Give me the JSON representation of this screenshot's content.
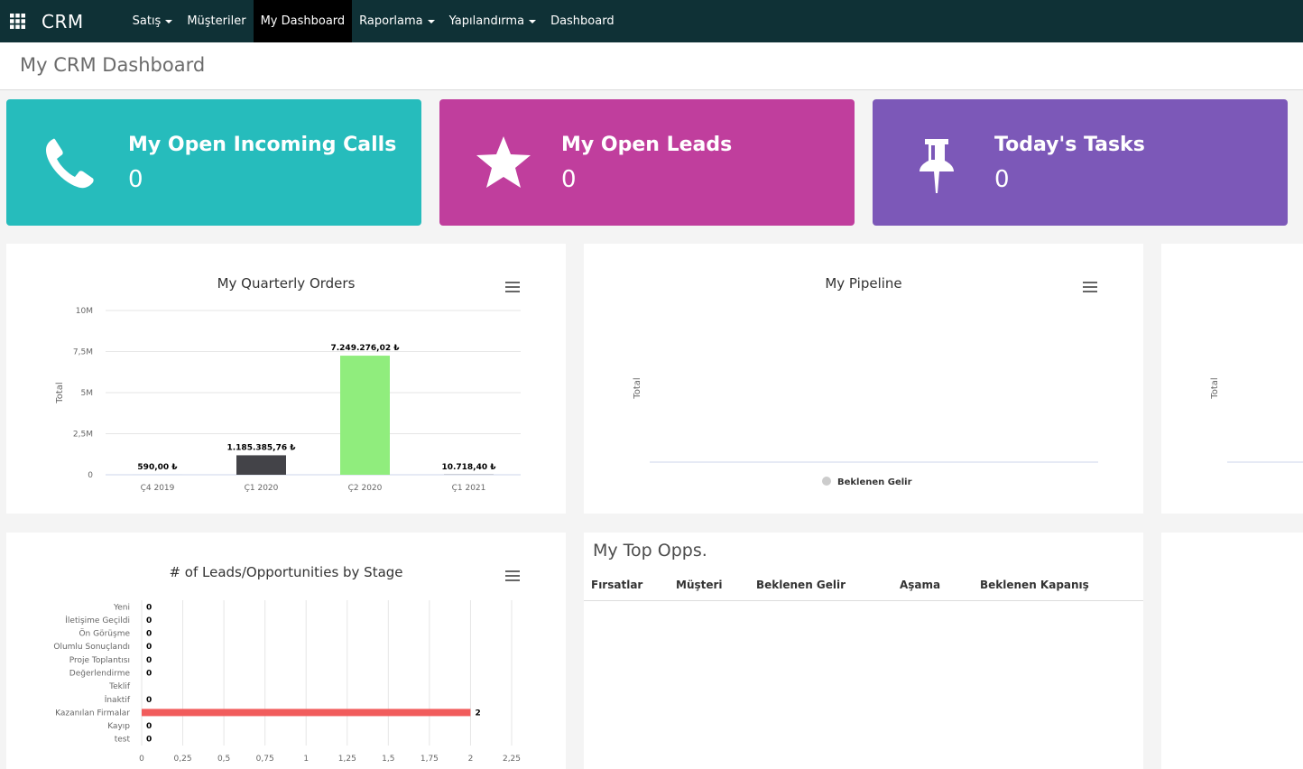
{
  "navbar": {
    "brand": "CRM",
    "menu": [
      {
        "label": "Satış",
        "dropdown": true
      },
      {
        "label": "Müşteriler",
        "dropdown": false
      },
      {
        "label": "My Dashboard",
        "dropdown": false,
        "active": true
      },
      {
        "label": "Raporlama",
        "dropdown": true
      },
      {
        "label": "Yapılandırma",
        "dropdown": true
      },
      {
        "label": "Dashboard",
        "dropdown": false
      }
    ]
  },
  "page": {
    "title": "My CRM Dashboard"
  },
  "kpis": [
    {
      "title": "My Open Incoming Calls",
      "value": "0",
      "icon": "phone-icon",
      "color": "#26bcbc"
    },
    {
      "title": "My Open Leads",
      "value": "0",
      "icon": "star-icon",
      "color": "#c03e9d"
    },
    {
      "title": "Today's Tasks",
      "value": "0",
      "icon": "pushpin-icon",
      "color": "#7c58b8"
    }
  ],
  "charts": {
    "quarterly": {
      "title": "My Quarterly Orders"
    },
    "pipeline": {
      "title": "My Pipeline"
    },
    "stages": {
      "title": "# of Leads/Opportunities by Stage"
    }
  },
  "top_opps": {
    "title": "My Top Opps.",
    "columns": [
      "Fırsatlar",
      "Müşteri",
      "Beklenen Gelir",
      "Aşama",
      "Beklenen Kapanış"
    ]
  },
  "chart_data": [
    {
      "type": "bar",
      "title": "My Quarterly Orders",
      "ylabel": "Total",
      "categories": [
        "Ç4 2019",
        "Ç1 2020",
        "Ç2 2020",
        "Ç1 2021"
      ],
      "values": [
        590.0,
        1185385.76,
        7249276.02,
        10718.4
      ],
      "data_labels": [
        "590,00 ₺",
        "1.185.385,76 ₺",
        "7.249.276,02 ₺",
        "10.718,40 ₺"
      ],
      "bar_colors": [
        "#434348",
        "#434348",
        "#90ed7d",
        "#434348"
      ],
      "yticks": [
        "0",
        "2,5M",
        "5M",
        "7,5M",
        "10M"
      ],
      "ylim": [
        0,
        10000000
      ],
      "grid": true
    },
    {
      "type": "line",
      "title": "My Pipeline",
      "ylabel": "Total",
      "series": [
        {
          "name": "Beklenen Gelir",
          "values": []
        }
      ],
      "legend": "bottom",
      "legend_color": "#cccccc"
    },
    {
      "type": "bar",
      "orientation": "horizontal",
      "title": "# of Leads/Opportunities by Stage",
      "categories": [
        "Yeni",
        "İletişime Geçildi",
        "Ön Görüşme",
        "Olumlu Sonuçlandı",
        "Proje Toplantısı",
        "Değerlendirme",
        "Teklif",
        "İnaktif",
        "Kazanılan Firmalar",
        "Kayıp",
        "test"
      ],
      "values": [
        0,
        0,
        0,
        0,
        0,
        0,
        null,
        0,
        2,
        0,
        0
      ],
      "data_labels": [
        "0",
        "0",
        "0",
        "0",
        "0",
        "0",
        "",
        "0",
        "2",
        "0",
        "0"
      ],
      "bar_color": "#f15c5c",
      "xticks": [
        "0",
        "0,25",
        "0,5",
        "0,75",
        "1",
        "1,25",
        "1,5",
        "1,75",
        "2",
        "2,25"
      ],
      "xlim": [
        0,
        2.25
      ],
      "grid": true
    },
    {
      "type": "line",
      "ylabel": "Total"
    }
  ]
}
